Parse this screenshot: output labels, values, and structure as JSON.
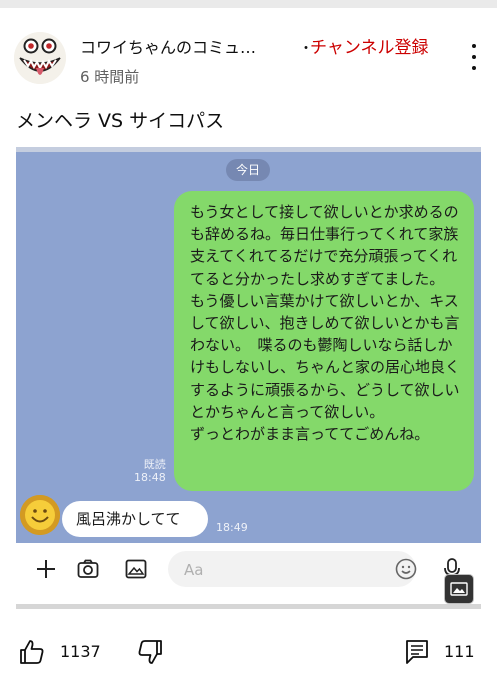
{
  "post": {
    "channel_name": "コワイちゃんのコミュ…",
    "separator": "・",
    "subscribe_label": "チャンネル登録",
    "time_ago": "6 時間前",
    "title": "メンヘラ VS サイコパス"
  },
  "chat": {
    "date_label": "今日",
    "sent_message": "もう女として接して欲しいとか求めるのも辞めるね。毎日仕事行ってくれて家族支えてくれてるだけで充分頑張ってくれてると分かったし求めすぎてました。\nもう優しい言葉かけて欲しいとか、キスして欲しい、抱きしめて欲しいとかも言わない。　喋るのも鬱陶しいなら話しかけもしないし、ちゃんと家の居心地良くするように頑張るから、どうして欲しいとかちゃんと言って欲しい。\nずっとわがまま言っててごめんね。",
    "read_status": "既読",
    "sent_time": "18:48",
    "reply_message": "風呂沸かしてて",
    "reply_time": "18:49",
    "input_placeholder": "Aa"
  },
  "footer": {
    "like_count": "1137",
    "comment_count": "111"
  },
  "colors": {
    "subscribe": "#cc0000",
    "chat_background": "#8da3d0",
    "sent_bubble": "#84d96a"
  },
  "icons": [
    "avatar",
    "more-vert-icon",
    "plus-icon",
    "camera-icon",
    "image-icon",
    "emoji-icon",
    "mic-icon",
    "gallery-icon",
    "thumbs-up-icon",
    "thumbs-down-icon",
    "comment-icon"
  ]
}
